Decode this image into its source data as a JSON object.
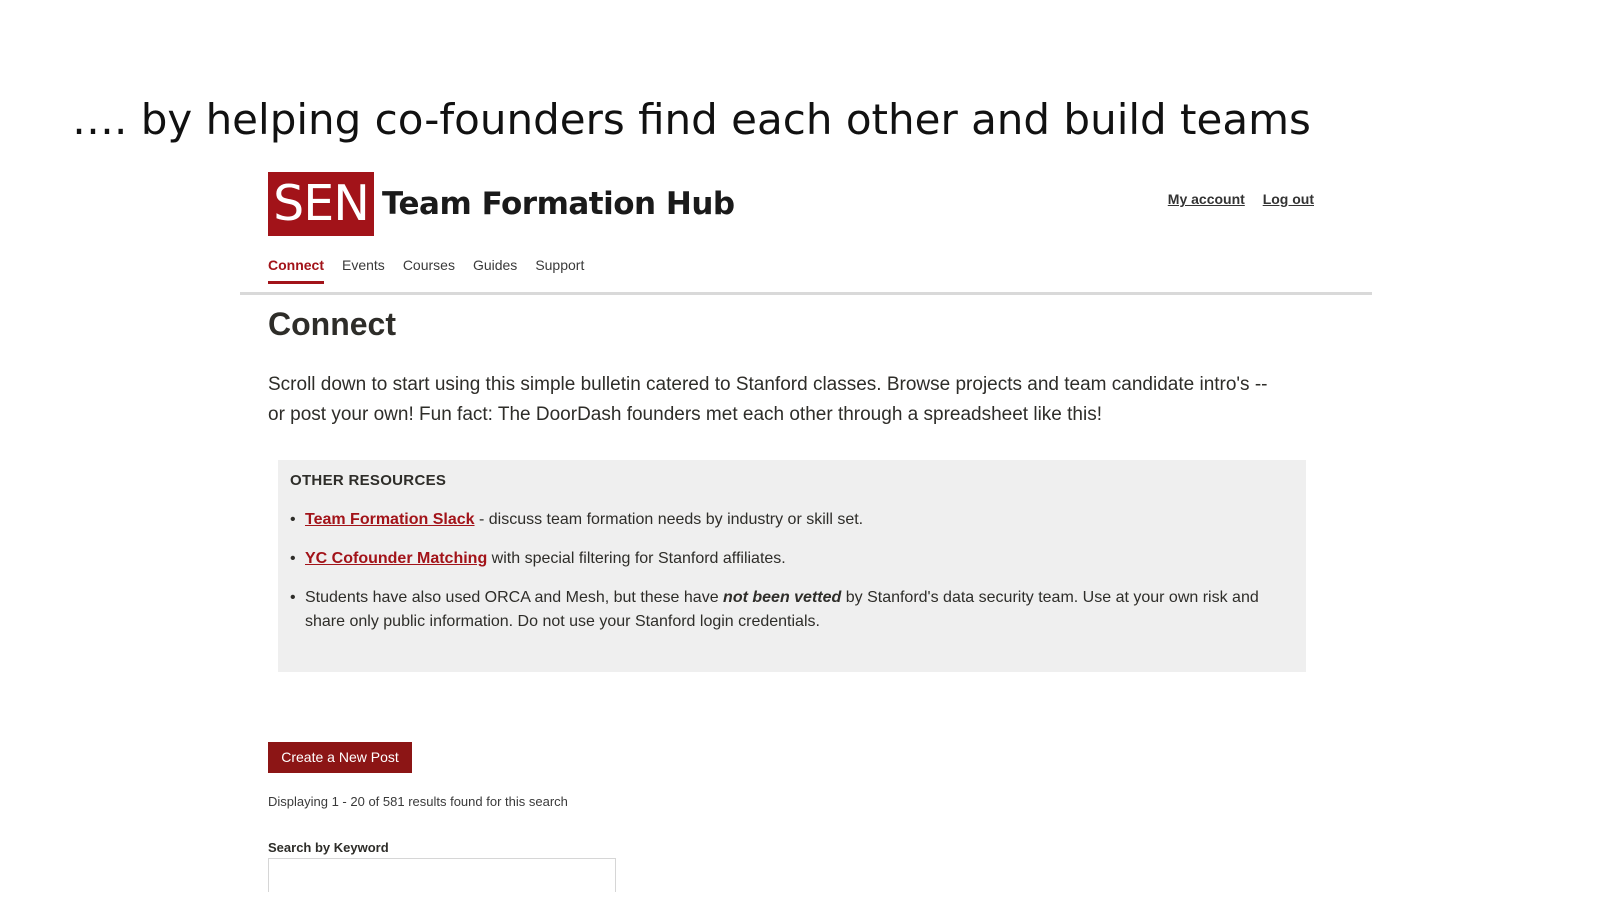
{
  "slide": {
    "title": "…. by helping co-founders find each other and build teams"
  },
  "header": {
    "logo_text": "SEN",
    "site_title": "Team Formation Hub",
    "my_account": "My account",
    "log_out": "Log out"
  },
  "nav": {
    "tabs": [
      {
        "label": "Connect",
        "active": true
      },
      {
        "label": "Events",
        "active": false
      },
      {
        "label": "Courses",
        "active": false
      },
      {
        "label": "Guides",
        "active": false
      },
      {
        "label": "Support",
        "active": false
      }
    ]
  },
  "main": {
    "heading": "Connect",
    "intro": "Scroll down to start using this simple bulletin catered to Stanford classes. Browse projects and team candidate intro's -- or post your own! Fun fact: The DoorDash founders met each other through a spreadsheet like this!",
    "resources": {
      "heading": "OTHER RESOURCES",
      "items": [
        {
          "link": "Team Formation Slack",
          "text": " - discuss team formation needs by industry or skill set."
        },
        {
          "link": "YC Cofounder Matching",
          "text": " with special filtering for Stanford affiliates."
        },
        {
          "text_before": "Students have also used ORCA and Mesh, but these have ",
          "emphasis": "not been vetted",
          "text_after": " by Stanford's data security team. Use at your own risk and share only public information. Do not use your Stanford login credentials."
        }
      ]
    },
    "create_button": "Create a New Post",
    "results_count": "Displaying 1 - 20 of 581 results found for this search",
    "search": {
      "label": "Search by Keyword",
      "value": "",
      "placeholder": ""
    }
  },
  "colors": {
    "brand": "#a21319",
    "button": "#8c1515",
    "resources_bg": "#efefef"
  }
}
